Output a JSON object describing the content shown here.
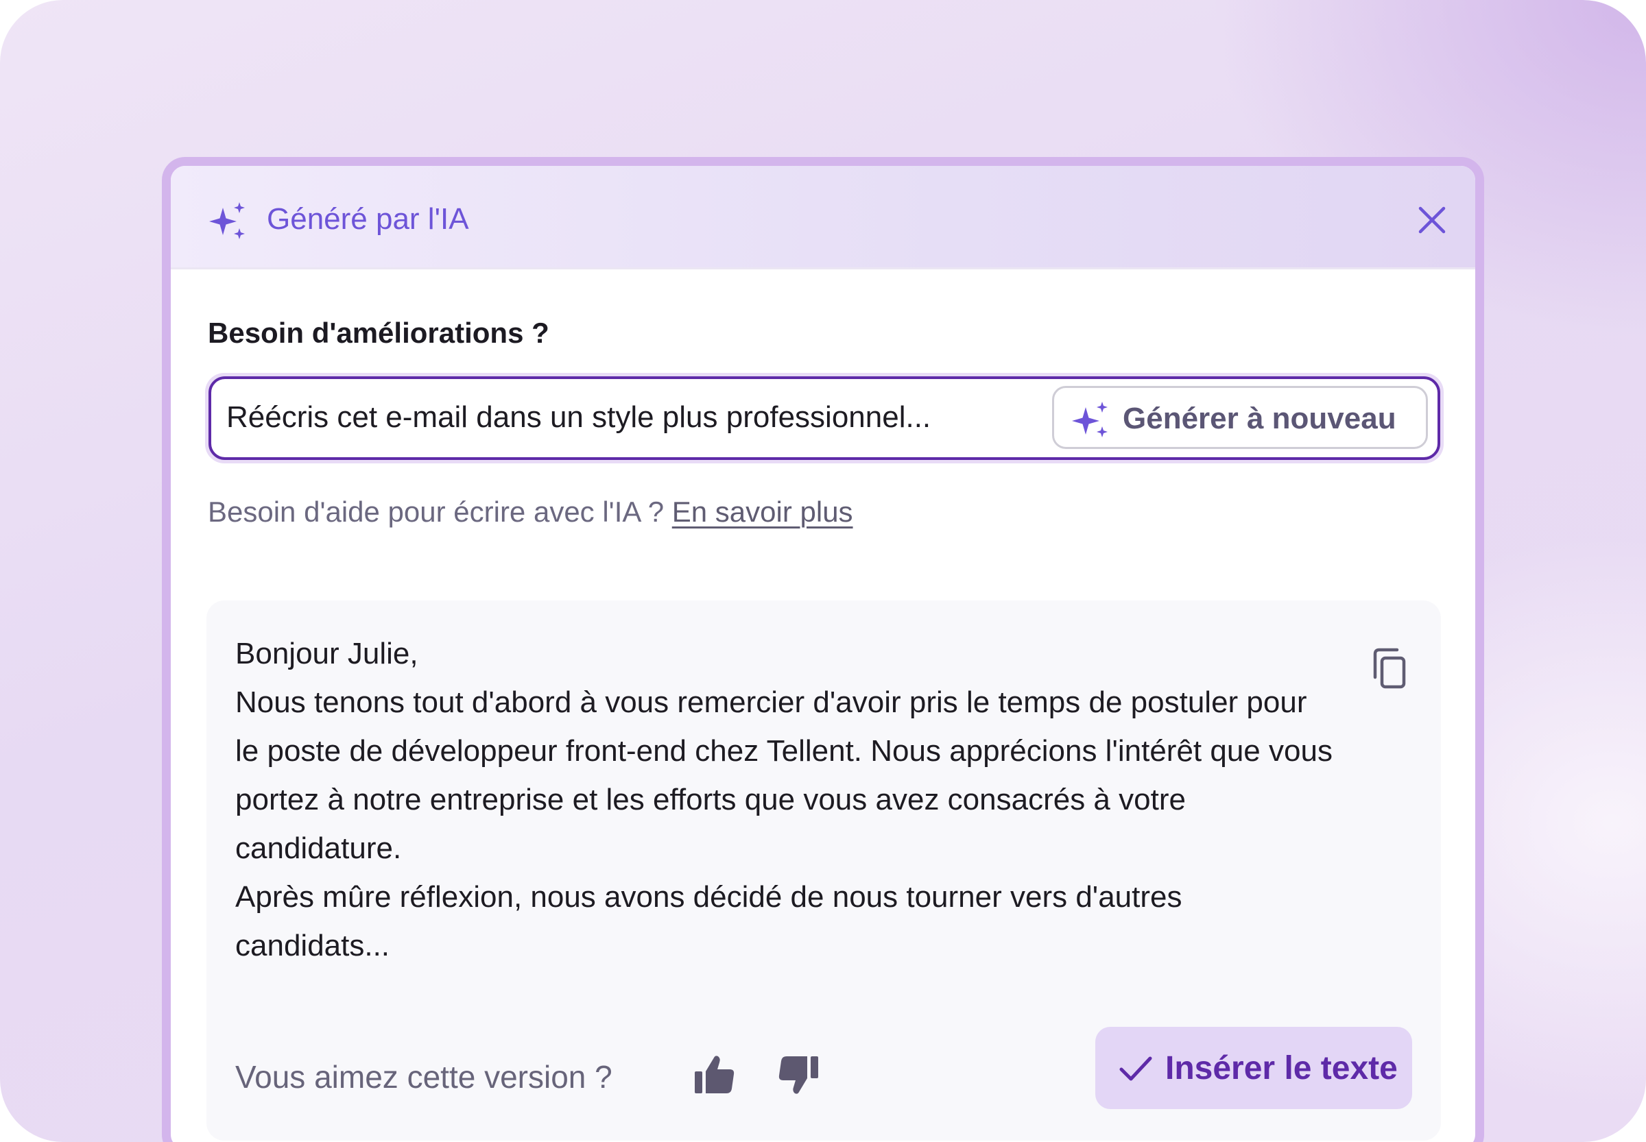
{
  "header": {
    "title": "Généré par l'IA",
    "icon": "sparkles-icon",
    "close_icon": "close-icon"
  },
  "improve": {
    "label": "Besoin d'améliorations ?",
    "prompt_value": "Réécris cet e-mail dans un style plus professionnel...",
    "regenerate_label": "Générer à nouveau"
  },
  "help": {
    "text": "Besoin d'aide pour écrire avec l'IA ? ",
    "link": "En savoir plus"
  },
  "result": {
    "paragraphs": [
      "Bonjour Julie,",
      "Nous tenons tout d'abord à vous remercier d'avoir pris le temps de postuler pour le poste de développeur front-end chez Tellent. Nous apprécions l'intérêt que vous portez à notre entreprise et les efforts que vous avez consacrés à votre candidature.",
      "Après mûre réflexion, nous avons décidé de nous tourner vers d'autres candidats..."
    ],
    "feedback_label": "Vous aimez cette version ?",
    "insert_label": "Insérer le texte"
  },
  "colors": {
    "accent": "#6d54d8",
    "accent_dark": "#5e2aa8",
    "button_bg": "#e3d6f6",
    "frame": "#d3b5ec"
  }
}
